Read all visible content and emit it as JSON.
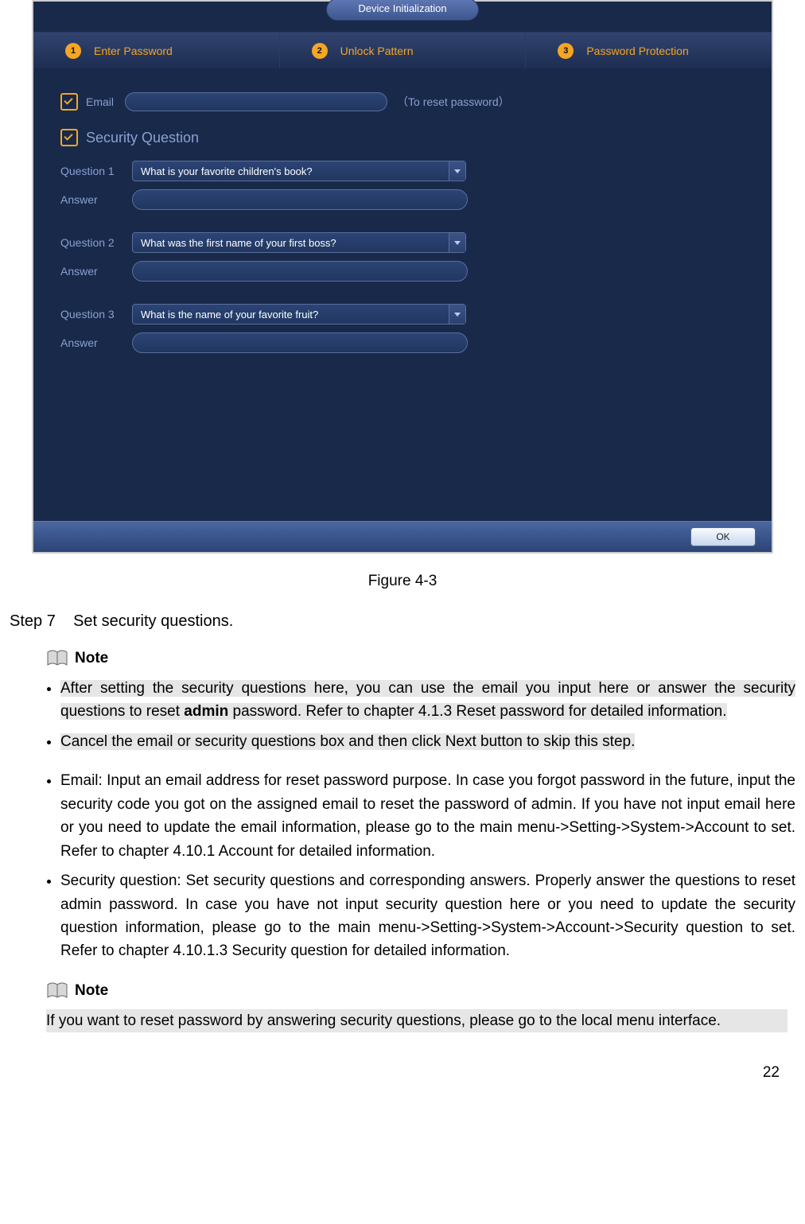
{
  "window": {
    "title": "Device Initialization",
    "steps": [
      {
        "num": "1",
        "label": "Enter Password"
      },
      {
        "num": "2",
        "label": "Unlock Pattern"
      },
      {
        "num": "3",
        "label": "Password Protection"
      }
    ],
    "email_label": "Email",
    "email_hint": "（To reset password）",
    "security_question_label": "Security Question",
    "questions": [
      {
        "q_label": "Question 1",
        "a_label": "Answer",
        "q_value": "What is your favorite children's book?"
      },
      {
        "q_label": "Question 2",
        "a_label": "Answer",
        "q_value": "What was the first name of your first boss?"
      },
      {
        "q_label": "Question 3",
        "a_label": "Answer",
        "q_value": "What is the name of your favorite fruit?"
      }
    ],
    "ok_label": "OK"
  },
  "figure_caption": "Figure 4-3",
  "step_line_prefix": "Step 7",
  "step_line_text": "Set security questions.",
  "note_label": "Note",
  "bullets1": {
    "b1_pre": "After setting the security questions here, you can use the email you input here or answer the security questions to reset ",
    "b1_bold": "admin",
    "b1_post": " password. Refer to chapter 4.1.3 Reset password for detailed information.",
    "b2": "Cancel the email or security questions box and then click Next button to skip this step."
  },
  "bullets2": {
    "b1": "Email: Input an email address for reset password purpose. In case you forgot password in the future, input the security code you got on the assigned email to reset the password of admin. If you have not input email here or you need to update the email information, please go to the main menu->Setting->System->Account to set. Refer to chapter 4.10.1 Account for detailed information.",
    "b2": "Security question: Set security questions and corresponding answers. Properly answer the questions to reset admin password. In case you have not input security question here or you need to update the security question information, please go to the main menu->Setting->System->Account->Security question to set. Refer to chapter 4.10.1.3 Security question for detailed information."
  },
  "note2_body": "If you want to reset password by answering security questions, please go to the local menu interface.",
  "page_number": "22"
}
